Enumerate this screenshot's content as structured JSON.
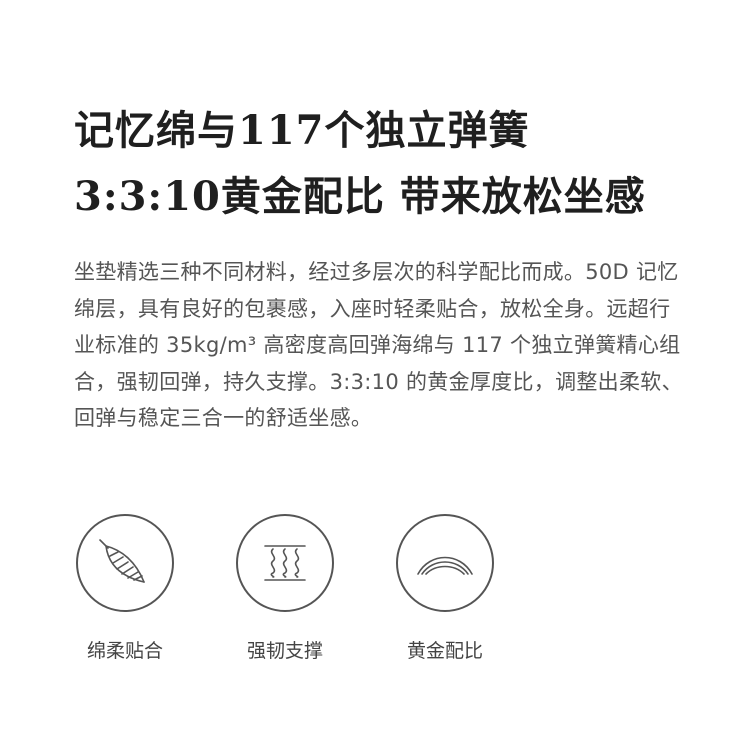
{
  "headline": {
    "line1": "记忆绵与117个独立弹簧",
    "line2": "3:3:10黄金配比 带来放松坐感"
  },
  "body": {
    "paragraph": "坐垫精选三种不同材料，经过多层次的科学配比而成。50D 记忆绵层，具有良好的包裹感，入座时轻柔贴合，放松全身。远超行业标准的 35kg/m³ 高密度高回弹海绵与 117 个独立弹簧精心组合，强韧回弹，持久支撑。3:3:10 的黄金厚度比，调整出柔软、回弹与稳定三合一的舒适坐感。"
  },
  "features": [
    {
      "icon": "feather-icon",
      "label": "绵柔贴合"
    },
    {
      "icon": "spring-coil-icon",
      "label": "强韧支撑"
    },
    {
      "icon": "layered-arcs-icon",
      "label": "黄金配比"
    }
  ],
  "colors": {
    "headline": "#1f1f1f",
    "body_text": "#555555",
    "icon_stroke": "#555555",
    "background": "#ffffff"
  }
}
